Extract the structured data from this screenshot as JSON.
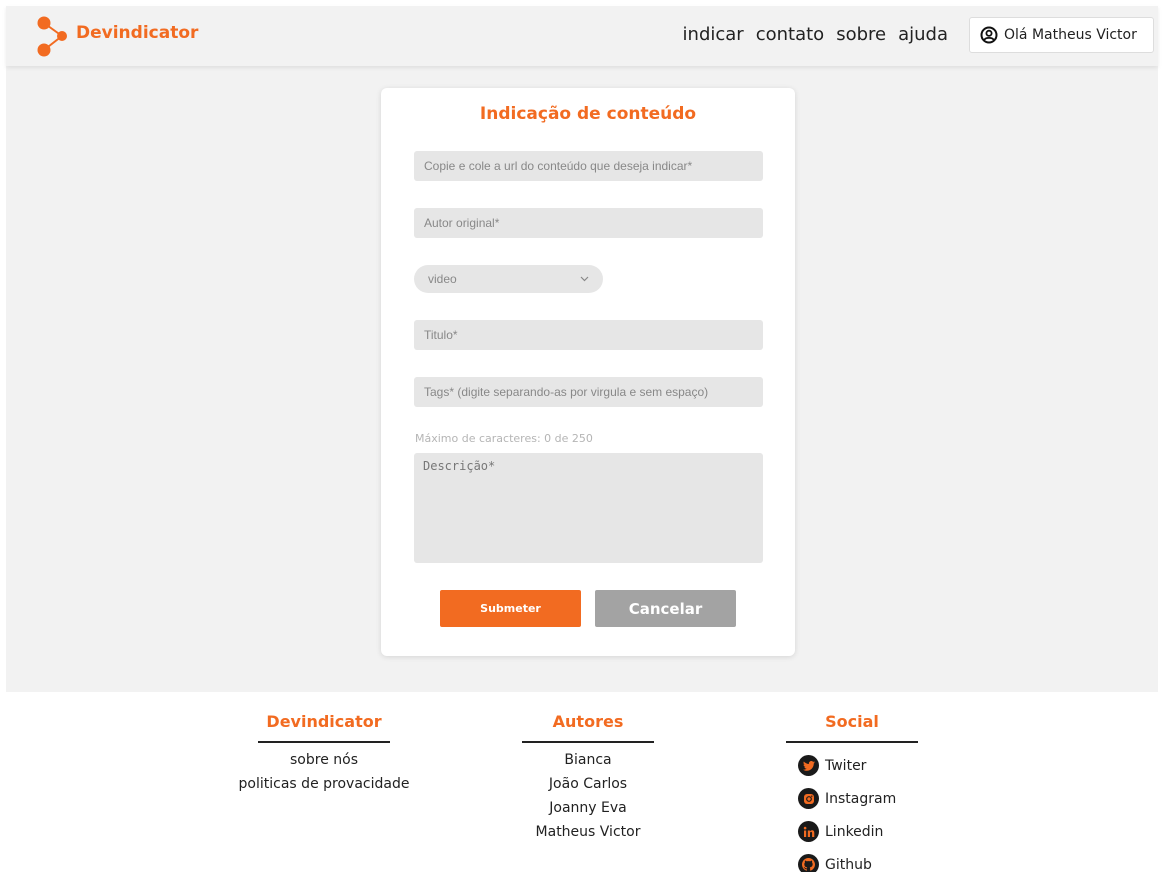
{
  "header": {
    "brand": "Devindicator",
    "nav": [
      "indicar",
      "contato",
      "sobre",
      "ajuda"
    ],
    "user_label": "Olá Matheus Victor"
  },
  "form": {
    "title": "Indicação de conteúdo",
    "url_placeholder": "Copie e cole a url do conteúdo que deseja indicar*",
    "author_placeholder": "Autor original*",
    "type_selected": "video",
    "title_placeholder": "Titulo*",
    "tags_placeholder": "Tags* (digite separando-as por virgula e sem espaço)",
    "char_count": "Máximo de caracteres: 0 de 250",
    "description_placeholder": "Descrição*",
    "submit_label": "Submeter",
    "cancel_label": "Cancelar"
  },
  "footer": {
    "devindicator": {
      "title": "Devindicator",
      "links": [
        "sobre nós",
        "politicas de provacidade"
      ]
    },
    "autores": {
      "title": "Autores",
      "names": [
        "Bianca",
        "João Carlos",
        "Joanny Eva",
        "Matheus Victor"
      ]
    },
    "social": {
      "title": "Social",
      "items": [
        {
          "label": "Twiter",
          "icon": "twitter-icon"
        },
        {
          "label": "Instagram",
          "icon": "instagram-icon"
        },
        {
          "label": "Linkedin",
          "icon": "linkedin-icon"
        },
        {
          "label": "Github",
          "icon": "github-icon"
        }
      ]
    }
  },
  "colors": {
    "accent": "#f26b21",
    "field_bg": "#e6e6e6",
    "cancel_bg": "#a3a3a3",
    "page_bg": "#f2f2f2"
  }
}
